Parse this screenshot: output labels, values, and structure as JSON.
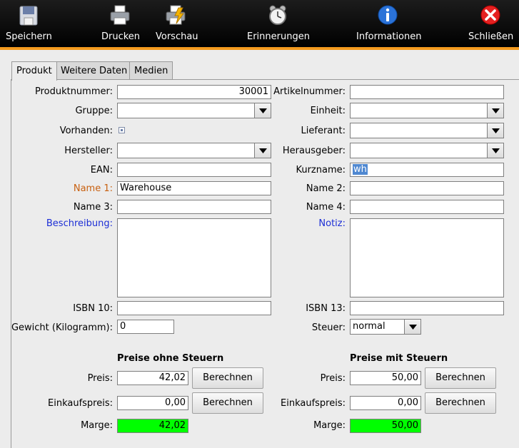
{
  "toolbar": {
    "save": "Speichern",
    "print": "Drucken",
    "preview": "Vorschau",
    "reminders": "Erinnerungen",
    "info": "Informationen",
    "close": "Schließen"
  },
  "tabs": [
    "Produkt",
    "Weitere Daten",
    "Medien"
  ],
  "form": {
    "produktnummer": {
      "label": "Produktnummer:",
      "value": "30001"
    },
    "artikelnummer": {
      "label": "Artikelnummer:",
      "value": ""
    },
    "gruppe": {
      "label": "Gruppe:",
      "value": ""
    },
    "einheit": {
      "label": "Einheit:",
      "value": ""
    },
    "vorhanden": {
      "label": "Vorhanden:"
    },
    "lieferant": {
      "label": "Lieferant:",
      "value": ""
    },
    "hersteller": {
      "label": "Hersteller:",
      "value": ""
    },
    "herausgeber": {
      "label": "Herausgeber:",
      "value": ""
    },
    "ean": {
      "label": "EAN:",
      "value": ""
    },
    "kurzname": {
      "label": "Kurzname:",
      "value": "wh"
    },
    "name1": {
      "label": "Name 1:",
      "value": "Warehouse"
    },
    "name2": {
      "label": "Name 2:",
      "value": ""
    },
    "name3": {
      "label": "Name 3:",
      "value": ""
    },
    "name4": {
      "label": "Name 4:",
      "value": ""
    },
    "beschreibung": {
      "label": "Beschreibung:",
      "value": ""
    },
    "notiz": {
      "label": "Notiz:",
      "value": ""
    },
    "isbn10": {
      "label": "ISBN 10:",
      "value": ""
    },
    "isbn13": {
      "label": "ISBN 13:",
      "value": ""
    },
    "gewicht": {
      "label": "Gewicht (Kilogramm):",
      "value": "0"
    },
    "steuer": {
      "label": "Steuer:",
      "value": "normal"
    }
  },
  "prices_net": {
    "title": "Preise ohne Steuern",
    "preis_label": "Preis:",
    "preis": "42,02",
    "einkauf_label": "Einkaufspreis:",
    "einkauf": "0,00",
    "marge_label": "Marge:",
    "marge": "42,02",
    "button": "Berechnen"
  },
  "prices_gross": {
    "title": "Preise mit Steuern",
    "preis_label": "Preis:",
    "preis": "50,00",
    "einkauf_label": "Einkaufspreis:",
    "einkauf": "0,00",
    "marge_label": "Marge:",
    "marge": "50,00",
    "button": "Berechnen"
  },
  "colors": {
    "toolbar_accent": "#f39a1e",
    "margin_ok": "#00ff00",
    "required_label": "#c86010",
    "text_label": "#1c2ed6"
  }
}
